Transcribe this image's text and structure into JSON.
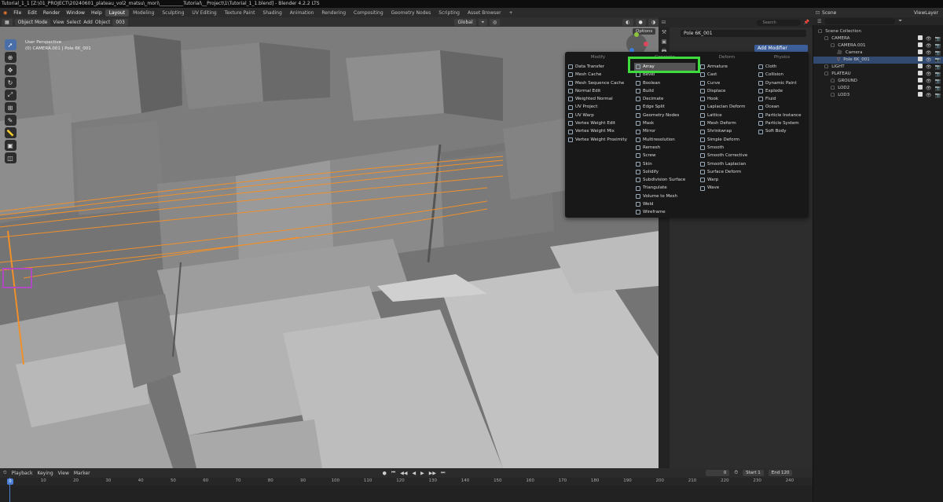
{
  "title": "Tutorial_1_1 [Z:\\01_PROJECT\\20240601_plateau_vol2_matsu\\_mori\\__________Tutorial\\__Project\\1\\Tutorial_1_1.blend] - Blender 4.2.2 LTS",
  "menu": [
    "File",
    "Edit",
    "Render",
    "Window",
    "Help"
  ],
  "workspaces": [
    "Layout",
    "Modeling",
    "Sculpting",
    "UV Editing",
    "Texture Paint",
    "Shading",
    "Animation",
    "Rendering",
    "Compositing",
    "Geometry Nodes",
    "Scripting",
    "Asset Browser"
  ],
  "active_workspace": "Layout",
  "viewport": {
    "mode": "Object Mode",
    "menus": [
      "View",
      "Select",
      "Add",
      "Object"
    ],
    "transform": "Global",
    "frame_field": "003",
    "options_label": "Options",
    "info_line1": "User Perspective",
    "info_line2": "(0) CAMERA.001 | Pole 6K_001"
  },
  "properties": {
    "search_placeholder": "Search",
    "object_name": "Pole 6K_001",
    "add_modifier_label": "Add Modifier"
  },
  "modifier_menu": {
    "columns": [
      {
        "header": "Modify",
        "items": [
          "Data Transfer",
          "Mesh Cache",
          "Mesh Sequence Cache",
          "Normal Edit",
          "Weighted Normal",
          "UV Project",
          "UV Warp",
          "Vertex Weight Edit",
          "Vertex Weight Mix",
          "Vertex Weight Proximity"
        ]
      },
      {
        "header": "Generate",
        "items": [
          "Array",
          "Bevel",
          "Boolean",
          "Build",
          "Decimate",
          "Edge Split",
          "Geometry Nodes",
          "Mask",
          "Mirror",
          "Multiresolution",
          "Remesh",
          "Screw",
          "Skin",
          "Solidify",
          "Subdivision Surface",
          "Triangulate",
          "Volume to Mesh",
          "Weld",
          "Wireframe"
        ]
      },
      {
        "header": "Deform",
        "items": [
          "Armature",
          "Cast",
          "Curve",
          "Displace",
          "Hook",
          "Laplacian Deform",
          "Lattice",
          "Mesh Deform",
          "Shrinkwrap",
          "Simple Deform",
          "Smooth",
          "Smooth Corrective",
          "Smooth Laplacian",
          "Surface Deform",
          "Warp",
          "Wave"
        ]
      },
      {
        "header": "Physics",
        "items": [
          "Cloth",
          "Collision",
          "Dynamic Paint",
          "Explode",
          "Fluid",
          "Ocean",
          "Particle Instance",
          "Particle System",
          "Soft Body"
        ]
      }
    ],
    "highlighted": "Array"
  },
  "outliner": {
    "scene_label": "Scene",
    "viewlayer_label": "ViewLayer",
    "rows": [
      {
        "label": "Scene Collection",
        "indent": 0,
        "icon": "collection-icon",
        "selected": false,
        "vis": false
      },
      {
        "label": "CAMERA",
        "indent": 1,
        "icon": "collection-icon",
        "selected": false,
        "vis": true
      },
      {
        "label": "CAMERA.001",
        "indent": 2,
        "icon": "collection-icon",
        "selected": false,
        "vis": true
      },
      {
        "label": "Camera",
        "indent": 3,
        "icon": "camera-icon",
        "selected": false,
        "vis": true
      },
      {
        "label": "Pole 6K_001",
        "indent": 3,
        "icon": "mesh-icon",
        "selected": true,
        "vis": true
      },
      {
        "label": "LIGHT",
        "indent": 1,
        "icon": "collection-icon",
        "selected": false,
        "vis": true
      },
      {
        "label": "PLATEAU",
        "indent": 1,
        "icon": "collection-icon",
        "selected": false,
        "vis": true
      },
      {
        "label": "GROUND",
        "indent": 2,
        "icon": "collection-icon",
        "selected": false,
        "vis": true
      },
      {
        "label": "LOD2",
        "indent": 2,
        "icon": "collection-icon",
        "selected": false,
        "vis": true
      },
      {
        "label": "LOD3",
        "indent": 2,
        "icon": "collection-icon",
        "selected": false,
        "vis": true
      }
    ]
  },
  "timeline": {
    "menus": [
      "Playback",
      "Keying",
      "View",
      "Marker"
    ],
    "current_frame": "0",
    "start_label": "Start",
    "start_value": "1",
    "end_label": "End",
    "end_value": "120",
    "ticks": [
      "0",
      "10",
      "20",
      "30",
      "40",
      "50",
      "60",
      "70",
      "80",
      "90",
      "100",
      "110",
      "120",
      "130",
      "140",
      "150",
      "160",
      "170",
      "180",
      "190",
      "200",
      "210",
      "220",
      "230",
      "240"
    ]
  },
  "colors": {
    "accent": "#4a7fd4",
    "highlight_box": "#3fdc3f",
    "selection_wire": "#f0902a"
  }
}
